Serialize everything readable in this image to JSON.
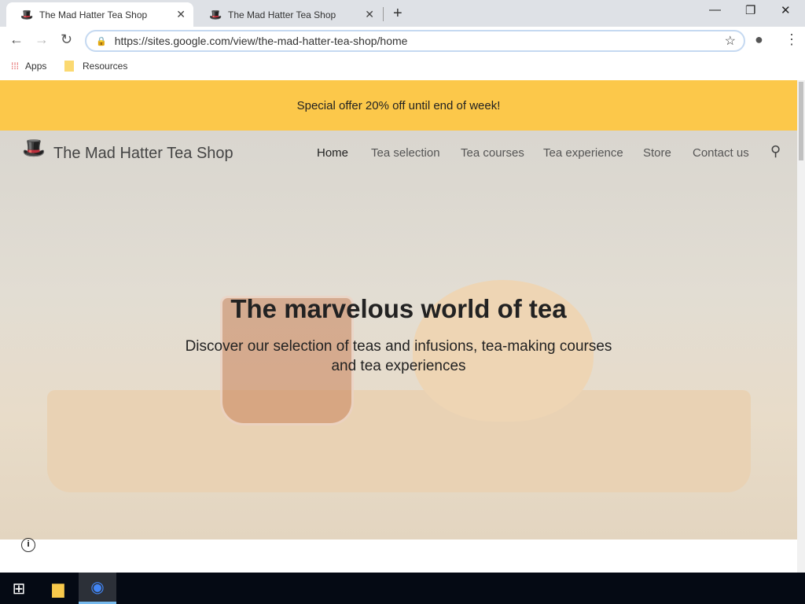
{
  "browser": {
    "tabs": [
      {
        "title": "The Mad Hatter Tea Shop",
        "active": true
      },
      {
        "title": "The Mad Hatter Tea Shop",
        "active": false
      }
    ],
    "url": "https://sites.google.com/view/the-mad-hatter-tea-shop/home",
    "bookmarks": [
      "Apps",
      "Resources"
    ]
  },
  "site": {
    "banner": "Special offer 20% off until end of week!",
    "title": "The Mad Hatter Tea Shop",
    "menu": [
      "Home",
      "Tea selection",
      "Tea courses",
      "Tea experience",
      "Store",
      "Contact us"
    ],
    "hero_title": "The marvelous world of tea",
    "hero_subtitle": "Discover our selection of teas and infusions, tea-making courses and tea experiences"
  },
  "colors": {
    "banner": "#fcc84a",
    "taskbar": "#050a14"
  }
}
